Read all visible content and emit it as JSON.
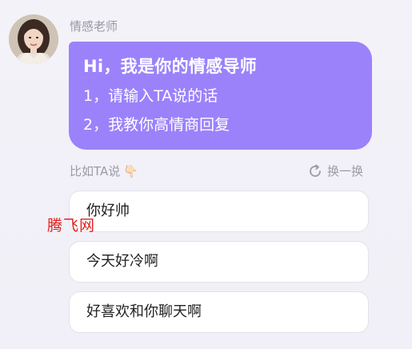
{
  "sender": {
    "name": "情感老师",
    "avatar_icon": "woman-portrait-avatar"
  },
  "message": {
    "title": "Hi，我是你的情感导师",
    "lines": [
      "1，请输入TA说的话",
      "2，我教你高情商回复"
    ],
    "bubble_color": "#9b82fb"
  },
  "suggestions_header": {
    "label": "比如TA说",
    "label_icon": "pointing-down-hand-icon",
    "refresh_label": "换一换",
    "refresh_icon": "refresh-icon"
  },
  "suggestions": [
    "你好帅",
    "今天好冷啊",
    "好喜欢和你聊天啊"
  ],
  "watermark": "腾飞网"
}
